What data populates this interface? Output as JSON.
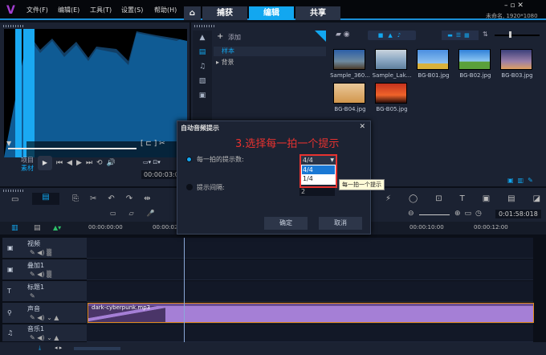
{
  "app": {
    "project_info": "未命名, 1920*1080"
  },
  "menu": [
    "文件(F)",
    "编辑(E)",
    "工具(T)",
    "设置(S)",
    "帮助(H)"
  ],
  "tabs": [
    {
      "label": "捕获",
      "active": false
    },
    {
      "label": "编辑",
      "active": true
    },
    {
      "label": "共享",
      "active": false
    }
  ],
  "player": {
    "project_label": "项目",
    "clip_label": "素材",
    "timecode": "00:00:03:0"
  },
  "library": {
    "add_label": "添加",
    "folders": [
      {
        "label": "样本",
        "selected": true
      },
      {
        "label": "背景",
        "selected": false
      }
    ],
    "items": [
      "Sample_360...",
      "Sample_Lak...",
      "BG-B01.jpg",
      "BG-B02.jpg",
      "BG-B03.jpg",
      "BG-B04.jpg",
      "BG-B05.jpg"
    ]
  },
  "timeline": {
    "timecode": "0:01:58:018",
    "ruler": [
      "00:00:00:00",
      "00:00:02",
      "00:00:10:00",
      "00:00:12:00"
    ],
    "tracks": [
      "视频",
      "叠加1",
      "标题1",
      "声音",
      "音乐1"
    ],
    "audio_clip": "dark-cyberpunk.mp3"
  },
  "dialog": {
    "title": "自动音频提示",
    "annotation": "3.选择每一拍一个提示",
    "option1_label": "每一拍的提示数:",
    "option2_label": "提示间隔:",
    "select_value": "4/4",
    "options": [
      "4/4",
      "1/4"
    ],
    "interval_value": "2",
    "tooltip": "每一拍一个提示",
    "ok": "确定",
    "cancel": "取消"
  },
  "colors": {
    "accent": "#12a7f0",
    "annotation": "#e8322f",
    "audio_clip": "#a57fd6"
  }
}
